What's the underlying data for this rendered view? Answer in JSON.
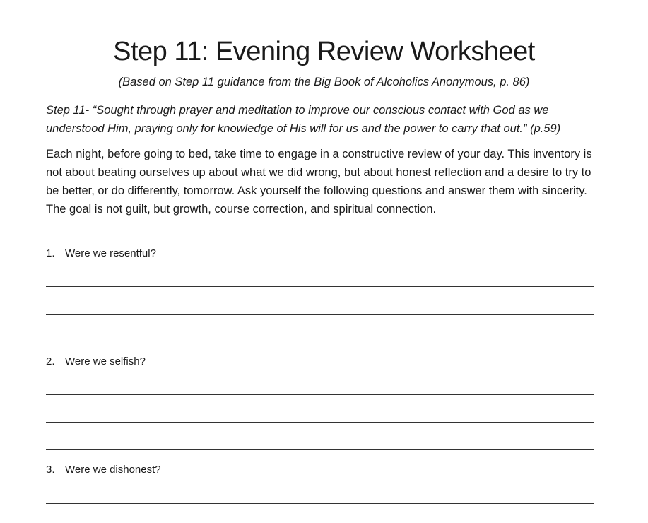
{
  "document": {
    "title": "Step 11: Evening Review Worksheet",
    "subtitle": "(Based on Step 11 guidance from the Big Book of Alcoholics Anonymous, p. 86)",
    "step_quote": "Step 11- “Sought through prayer and meditation to improve our conscious contact with God as we understood Him, praying only for knowledge of His will for us and the power to carry that out.” (p.59)",
    "intro": "Each night, before going to bed, take time to engage in a constructive review of your day. This inventory is not about beating ourselves up about what we did wrong, but about honest reflection and a desire to try to be better, or do differently, tomorrow. Ask yourself the following questions and answer them with sincerity. The goal is not guilt, but growth, course correction, and spiritual connection.",
    "questions": [
      {
        "number": "1.",
        "text": "Were we resentful?"
      },
      {
        "number": "2.",
        "text": "Were we selfish?"
      },
      {
        "number": "3.",
        "text": "Were we dishonest?"
      }
    ]
  }
}
